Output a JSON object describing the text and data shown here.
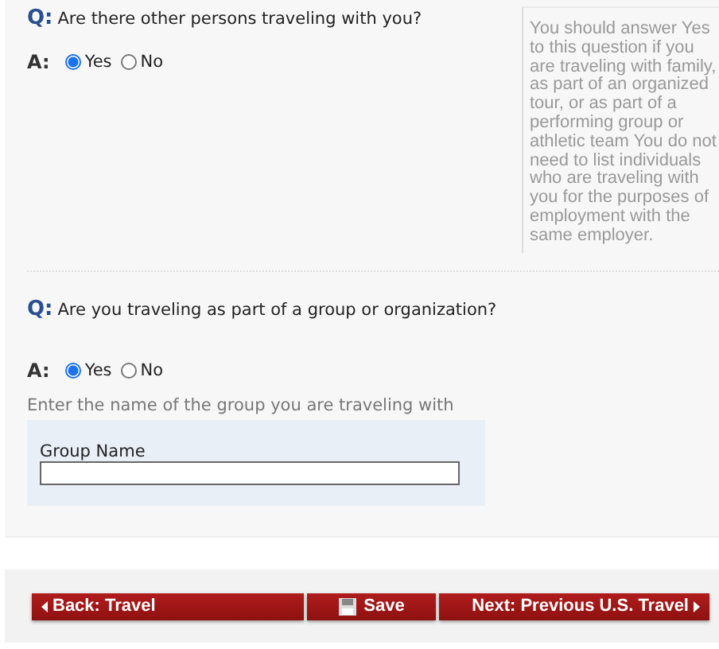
{
  "questions": [
    {
      "question": "Are there other persons traveling with you?",
      "q_label": "Q:",
      "a_label": "A:",
      "options": [
        {
          "label": "Yes",
          "selected": true
        },
        {
          "label": "No",
          "selected": false
        }
      ]
    },
    {
      "question": "Are you traveling as part of a group or organization?",
      "q_label": "Q:",
      "a_label": "A:",
      "options": [
        {
          "label": "Yes",
          "selected": true
        },
        {
          "label": "No",
          "selected": false
        }
      ],
      "instruction": "Enter the name of the group you are traveling with",
      "field": {
        "label": "Group Name"
      }
    }
  ],
  "help_text": "You should answer Yes to this question if you are traveling with family, as part of an organized tour, or as part of a performing group or athletic team You do not need to list individuals who are traveling with you for the purposes of employment with the same employer.",
  "buttons": [
    {
      "kind": "back",
      "label": "Back: Travel"
    },
    {
      "kind": "save",
      "label": "Save"
    },
    {
      "kind": "next",
      "label": "Next: Previous U.S. Travel"
    }
  ]
}
